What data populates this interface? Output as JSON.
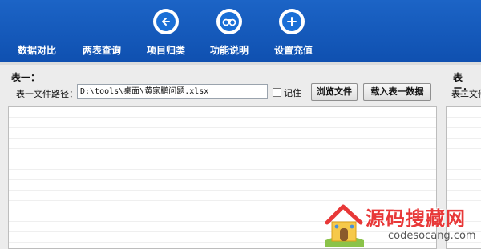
{
  "toolbar": {
    "items": [
      {
        "label": "数据对比",
        "icon": "compare-icon"
      },
      {
        "label": "两表查询",
        "icon": "query-icon"
      },
      {
        "label": "项目归类",
        "icon": "back-arrow-icon"
      },
      {
        "label": "功能说明",
        "icon": "binoculars-icon"
      },
      {
        "label": "设置充值",
        "icon": "plus-icon"
      }
    ]
  },
  "table1": {
    "title": "表一：",
    "path_label": "表一文件路径：",
    "path_value": "D:\\tools\\桌面\\黄家鹏问题.xlsx",
    "remember_label": "记住",
    "browse_button": "浏览文件",
    "load_button": "载入表一数据"
  },
  "table2": {
    "title": "表二：",
    "path_label": "表二文件"
  },
  "watermark": {
    "title": "源码搜藏网",
    "subtitle": "codesocang.com"
  },
  "colors": {
    "toolbar_bg": "#1560c2",
    "icon_inner": "#1a6fd6",
    "watermark_red": "#e83838"
  }
}
